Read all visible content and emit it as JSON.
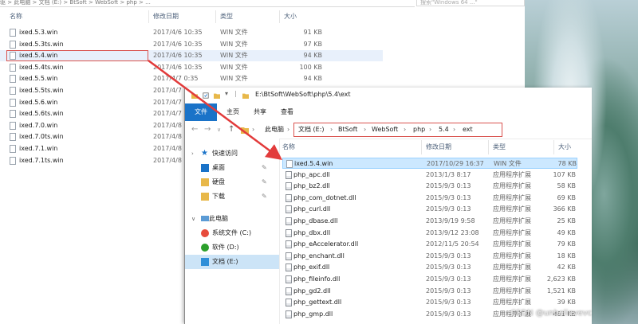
{
  "background_window": {
    "address_partial": "驱 > 此电脑 > 文档 (E:) > BtSoft > WebSoft > php > ...",
    "search_placeholder": "搜索\"Windows 64 ...\"",
    "columns": {
      "name": "名称",
      "date": "修改日期",
      "type": "类型",
      "size": "大小"
    },
    "files": [
      {
        "name": "ixed.5.3.win",
        "date": "2017/4/6 10:35",
        "type": "WIN 文件",
        "size": "91 KB"
      },
      {
        "name": "ixed.5.3ts.win",
        "date": "2017/4/6 10:35",
        "type": "WIN 文件",
        "size": "97 KB"
      },
      {
        "name": "ixed.5.4.win",
        "date": "2017/4/6 10:35",
        "type": "WIN 文件",
        "size": "94 KB"
      },
      {
        "name": "ixed.5.4ts.win",
        "date": "2017/4/6 10:35",
        "type": "WIN 文件",
        "size": "100 KB"
      },
      {
        "name": "ixed.5.5.win",
        "date": "2017/4/7 0:35",
        "type": "WIN 文件",
        "size": "94 KB"
      },
      {
        "name": "ixed.5.5ts.win",
        "date": "2017/4/7",
        "type": "",
        "size": ""
      },
      {
        "name": "ixed.5.6.win",
        "date": "2017/4/7",
        "type": "",
        "size": ""
      },
      {
        "name": "ixed.5.6ts.win",
        "date": "2017/4/7",
        "type": "",
        "size": ""
      },
      {
        "name": "ixed.7.0.win",
        "date": "2017/4/8",
        "type": "",
        "size": ""
      },
      {
        "name": "ixed.7.0ts.win",
        "date": "2017/4/8",
        "type": "",
        "size": ""
      },
      {
        "name": "ixed.7.1.win",
        "date": "2017/4/8",
        "type": "",
        "size": ""
      },
      {
        "name": "ixed.7.1ts.win",
        "date": "2017/4/8",
        "type": "",
        "size": ""
      }
    ]
  },
  "front_window": {
    "title": "E:\\BtSoft\\WebSoft\\php\\5.4\\ext",
    "ribbon_tabs": [
      "文件",
      "主页",
      "共享",
      "查看"
    ],
    "breadcrumb": [
      "此电脑",
      "文档 (E:)",
      "BtSoft",
      "WebSoft",
      "php",
      "5.4",
      "ext"
    ],
    "nav_pane": {
      "quick_access": "快速访问",
      "items": [
        "桌面",
        "硬盘",
        "下载"
      ],
      "this_pc": "此电脑",
      "drives": [
        "系统文件 (C:)",
        "软件 (D:)",
        "文档 (E:)"
      ]
    },
    "columns": {
      "name": "名称",
      "date": "修改日期",
      "type": "类型",
      "size": "大小"
    },
    "files": [
      {
        "name": "ixed.5.4.win",
        "date": "2017/10/29 16:37",
        "type": "WIN 文件",
        "size": "78 KB"
      },
      {
        "name": "php_apc.dll",
        "date": "2013/1/3 8:17",
        "type": "应用程序扩展",
        "size": "107 KB"
      },
      {
        "name": "php_bz2.dll",
        "date": "2015/9/3 0:13",
        "type": "应用程序扩展",
        "size": "58 KB"
      },
      {
        "name": "php_com_dotnet.dll",
        "date": "2015/9/3 0:13",
        "type": "应用程序扩展",
        "size": "69 KB"
      },
      {
        "name": "php_curl.dll",
        "date": "2015/9/3 0:13",
        "type": "应用程序扩展",
        "size": "366 KB"
      },
      {
        "name": "php_dbase.dll",
        "date": "2013/9/19 9:58",
        "type": "应用程序扩展",
        "size": "25 KB"
      },
      {
        "name": "php_dbx.dll",
        "date": "2013/9/12 23:08",
        "type": "应用程序扩展",
        "size": "49 KB"
      },
      {
        "name": "php_eAccelerator.dll",
        "date": "2012/11/5 20:54",
        "type": "应用程序扩展",
        "size": "79 KB"
      },
      {
        "name": "php_enchant.dll",
        "date": "2015/9/3 0:13",
        "type": "应用程序扩展",
        "size": "18 KB"
      },
      {
        "name": "php_exif.dll",
        "date": "2015/9/3 0:13",
        "type": "应用程序扩展",
        "size": "42 KB"
      },
      {
        "name": "php_fileinfo.dll",
        "date": "2015/9/3 0:13",
        "type": "应用程序扩展",
        "size": "2,623 KB"
      },
      {
        "name": "php_gd2.dll",
        "date": "2015/9/3 0:13",
        "type": "应用程序扩展",
        "size": "1,521 KB"
      },
      {
        "name": "php_gettext.dll",
        "date": "2015/9/3 0:13",
        "type": "应用程序扩展",
        "size": "39 KB"
      },
      {
        "name": "php_gmp.dll",
        "date": "2015/9/3 0:13",
        "type": "应用程序扩展",
        "size": "461 KB"
      }
    ]
  },
  "watermark": "CSDN @unbelievevc",
  "colors": {
    "accent": "#1a73c8",
    "highlight_red": "#d9534f",
    "selection": "#cce8ff"
  }
}
